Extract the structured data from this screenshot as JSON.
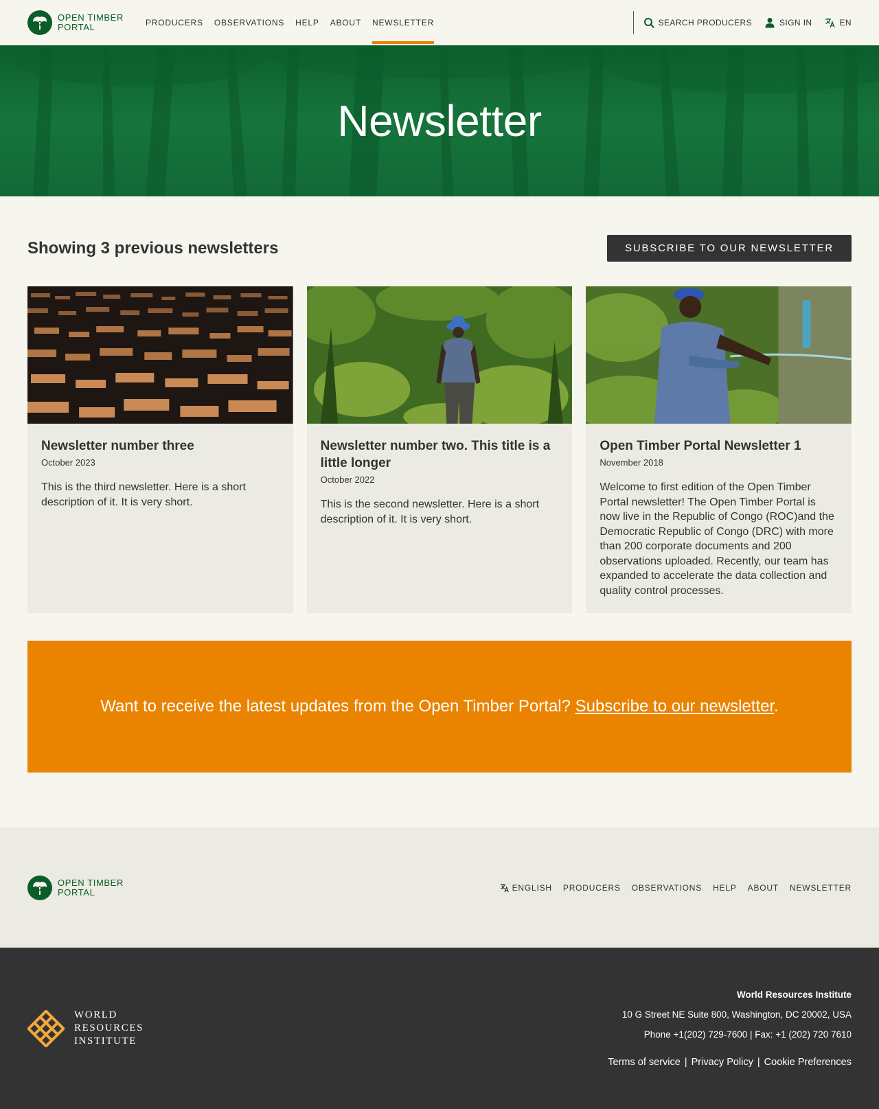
{
  "header": {
    "logo_line1": "OPEN TIMBER",
    "logo_line2": "PORTAL",
    "nav": [
      {
        "label": "PRODUCERS"
      },
      {
        "label": "OBSERVATIONS"
      },
      {
        "label": "HELP"
      },
      {
        "label": "ABOUT"
      },
      {
        "label": "NEWSLETTER",
        "active": true
      }
    ],
    "search_label": "SEARCH PRODUCERS",
    "signin_label": "SIGN IN",
    "lang_label": "EN"
  },
  "hero": {
    "title": "Newsletter"
  },
  "main": {
    "list_title": "Showing 3 previous newsletters",
    "subscribe_button": "SUBSCRIBE TO OUR NEWSLETTER",
    "cards": [
      {
        "title": "Newsletter number three",
        "date": "October 2023",
        "description": "This is the third newsletter. Here is a short description of it. It is very short."
      },
      {
        "title": "Newsletter number two. This title is a little longer",
        "date": "October 2022",
        "description": "This is the second newsletter. Here is a short description of it. It is very short."
      },
      {
        "title": "Open Timber Portal Newsletter 1",
        "date": "November 2018",
        "description": "Welcome to first edition of the Open Timber Portal newsletter! The Open Timber Portal is now live in the Republic of Congo (ROC)and the Democratic Republic of Congo (DRC) with more than 200 corporate documents and 200 observations uploaded. Recently, our team has expanded to accelerate the data collection and quality control processes."
      }
    ],
    "promo_text": "Want to receive the latest updates from the Open Timber Portal? ",
    "promo_link": "Subscribe to our newsletter",
    "promo_end": "."
  },
  "footer": {
    "logo_line1": "OPEN TIMBER",
    "logo_line2": "PORTAL",
    "lang_label": "ENGLISH",
    "nav": [
      {
        "label": "PRODUCERS"
      },
      {
        "label": "OBSERVATIONS"
      },
      {
        "label": "HELP"
      },
      {
        "label": "ABOUT"
      },
      {
        "label": "NEWSLETTER"
      }
    ]
  },
  "footer_dark": {
    "wri_line1": "WORLD",
    "wri_line2": "RESOURCES",
    "wri_line3": "INSTITUTE",
    "org": "World Resources Institute",
    "address": "10 G Street NE Suite 800, Washington, DC 20002, USA",
    "phone": "Phone +1(202) 729-7600 | Fax: +1 (202) 720 7610",
    "terms": "Terms of service",
    "privacy": "Privacy Policy",
    "cookies": "Cookie Preferences",
    "sep": "|"
  },
  "colors": {
    "brand_green": "#0b5c2a",
    "accent_orange": "#e98300",
    "dark": "#333333",
    "background": "#f6f6ef",
    "card_bg": "#ecebe3",
    "wri_gold": "#f2a93b"
  }
}
